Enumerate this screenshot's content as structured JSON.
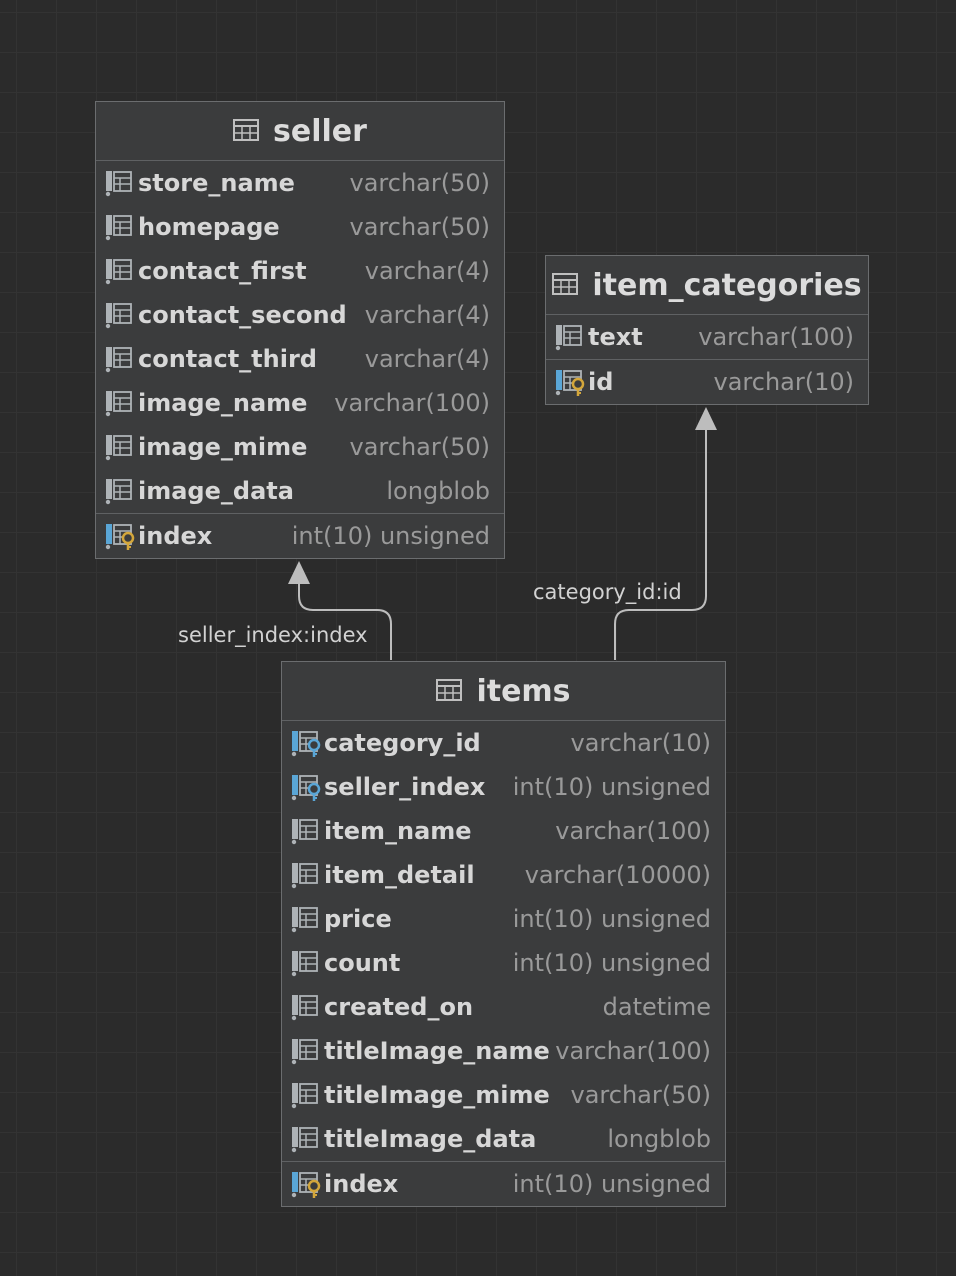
{
  "tables": {
    "seller": {
      "title": "seller",
      "columns": [
        {
          "name": "store_name",
          "type": "varchar(50)"
        },
        {
          "name": "homepage",
          "type": "varchar(50)"
        },
        {
          "name": "contact_first",
          "type": "varchar(4)"
        },
        {
          "name": "contact_second",
          "type": "varchar(4)"
        },
        {
          "name": "contact_third",
          "type": "varchar(4)"
        },
        {
          "name": "image_name",
          "type": "varchar(100)"
        },
        {
          "name": "image_mime",
          "type": "varchar(50)"
        },
        {
          "name": "image_data",
          "type": "longblob"
        }
      ],
      "primary": {
        "name": "index",
        "type": "int(10) unsigned"
      }
    },
    "item_categories": {
      "title": "item_categories",
      "columns": [
        {
          "name": "text",
          "type": "varchar(100)"
        }
      ],
      "primary": {
        "name": "id",
        "type": "varchar(10)"
      }
    },
    "items": {
      "title": "items",
      "columns": [
        {
          "name": "category_id",
          "type": "varchar(10)"
        },
        {
          "name": "seller_index",
          "type": "int(10) unsigned"
        },
        {
          "name": "item_name",
          "type": "varchar(100)"
        },
        {
          "name": "item_detail",
          "type": "varchar(10000)"
        },
        {
          "name": "price",
          "type": "int(10) unsigned"
        },
        {
          "name": "count",
          "type": "int(10) unsigned"
        },
        {
          "name": "created_on",
          "type": "datetime"
        },
        {
          "name": "titleImage_name",
          "type": "varchar(100)"
        },
        {
          "name": "titleImage_mime",
          "type": "varchar(50)"
        },
        {
          "name": "titleImage_data",
          "type": "longblob"
        }
      ],
      "primary": {
        "name": "index",
        "type": "int(10) unsigned"
      }
    }
  },
  "relations": {
    "seller_link": "seller_index:index",
    "category_link": "category_id:id"
  },
  "icons": {
    "table": "table-icon",
    "column": "column-icon",
    "primary_key": "primary-key-icon",
    "foreign_key": "foreign-key-icon"
  },
  "colors": {
    "background": "#2b2b2b",
    "table_bg": "#3b3c3d",
    "key_gold": "#d4a73b",
    "key_blue": "#5aa6d6"
  }
}
